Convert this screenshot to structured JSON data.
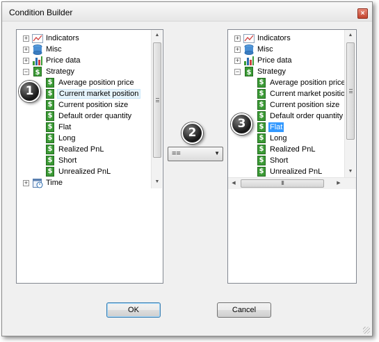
{
  "window": {
    "title": "Condition Builder",
    "close_glyph": "×"
  },
  "left_tree": {
    "items": [
      {
        "label": "Indicators",
        "kind": "category",
        "expander": "+",
        "icon": "indicators-icon"
      },
      {
        "label": "Misc",
        "kind": "category",
        "expander": "+",
        "icon": "misc-icon"
      },
      {
        "label": "Price data",
        "kind": "category",
        "expander": "+",
        "icon": "price-data-icon"
      },
      {
        "label": "Strategy",
        "kind": "category",
        "expander": "−",
        "icon": "strategy-icon"
      },
      {
        "label": "Average position price",
        "kind": "leaf"
      },
      {
        "label": "Current market position",
        "kind": "leaf",
        "state": "hover"
      },
      {
        "label": "Current position size",
        "kind": "leaf"
      },
      {
        "label": "Default order quantity",
        "kind": "leaf"
      },
      {
        "label": "Flat",
        "kind": "leaf"
      },
      {
        "label": "Long",
        "kind": "leaf"
      },
      {
        "label": "Realized PnL",
        "kind": "leaf"
      },
      {
        "label": "Short",
        "kind": "leaf"
      },
      {
        "label": "Unrealized PnL",
        "kind": "leaf"
      },
      {
        "label": "Time",
        "kind": "category",
        "expander": "+",
        "icon": "time-icon"
      }
    ]
  },
  "operator": {
    "value": "==",
    "arrow": "▼"
  },
  "right_tree": {
    "items": [
      {
        "label": "Indicators",
        "kind": "category",
        "expander": "+",
        "icon": "indicators-icon"
      },
      {
        "label": "Misc",
        "kind": "category",
        "expander": "+",
        "icon": "misc-icon"
      },
      {
        "label": "Price data",
        "kind": "category",
        "expander": "+",
        "icon": "price-data-icon"
      },
      {
        "label": "Strategy",
        "kind": "category",
        "expander": "−",
        "icon": "strategy-icon"
      },
      {
        "label": "Average position price",
        "kind": "leaf"
      },
      {
        "label": "Current market positio",
        "kind": "leaf"
      },
      {
        "label": "Current position size",
        "kind": "leaf"
      },
      {
        "label": "Default order quantity",
        "kind": "leaf"
      },
      {
        "label": "Flat",
        "kind": "leaf",
        "state": "selected"
      },
      {
        "label": "Long",
        "kind": "leaf"
      },
      {
        "label": "Realized PnL",
        "kind": "leaf"
      },
      {
        "label": "Short",
        "kind": "leaf"
      },
      {
        "label": "Unrealized PnL",
        "kind": "leaf"
      }
    ]
  },
  "callouts": {
    "one": "1",
    "two": "2",
    "three": "3"
  },
  "scroll_glyphs": {
    "up": "▲",
    "down": "▼",
    "left": "◀",
    "right": "▶",
    "hthumb": "III"
  },
  "buttons": {
    "ok": "OK",
    "cancel": "Cancel"
  },
  "leaf_icon_glyph": "$",
  "colors": {
    "selection": "#3399ff",
    "leaf_icon": "#3b9a35",
    "close_button": "#c1432d"
  }
}
